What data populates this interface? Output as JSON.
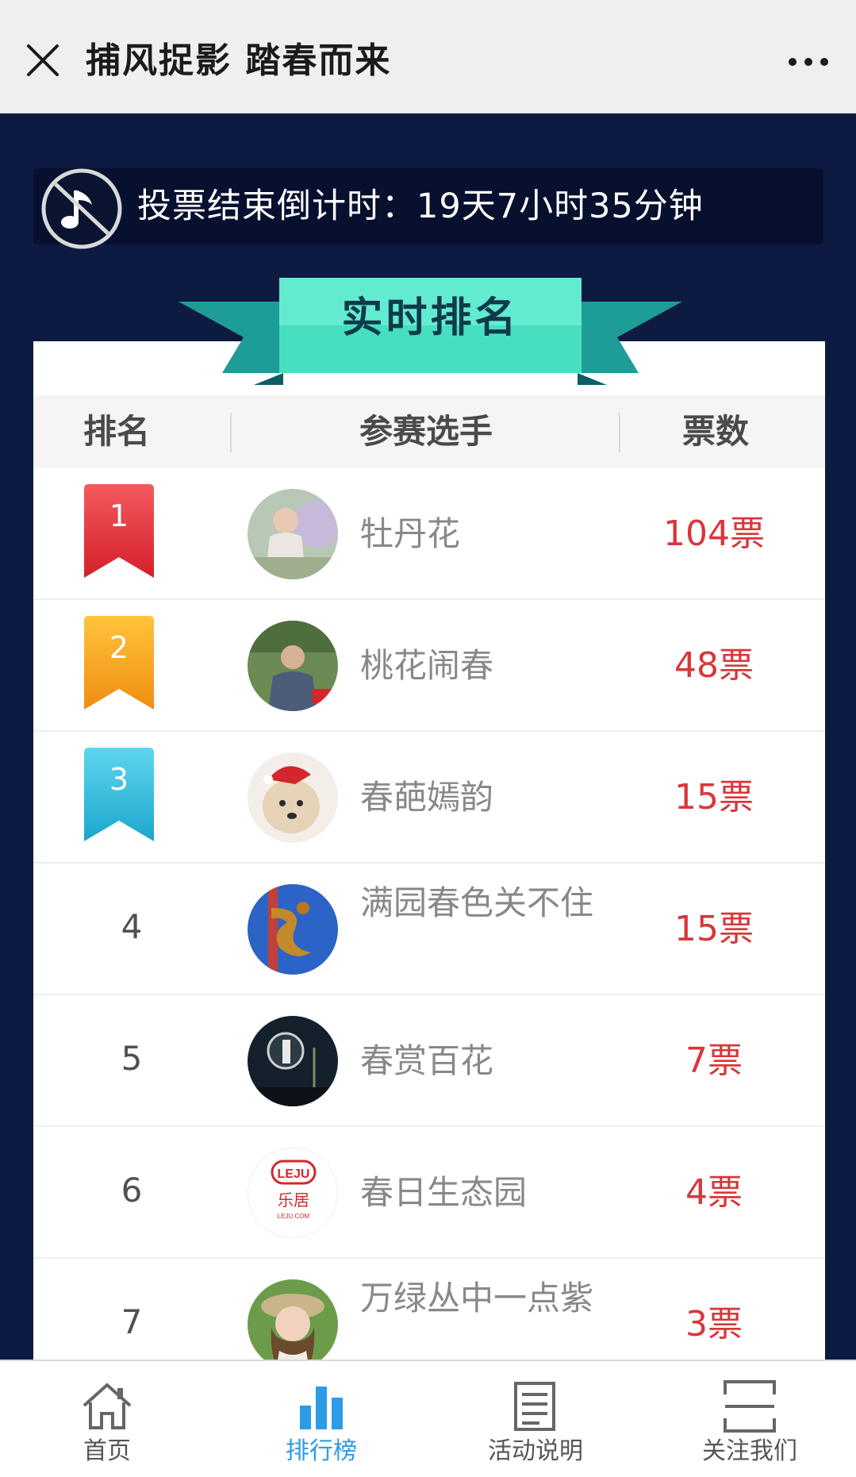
{
  "header": {
    "title": "捕风捉影 踏春而来"
  },
  "countdown": {
    "label": "投票结束倒计时：",
    "value": "19天7小时35分钟"
  },
  "banner": {
    "title": "实时排名"
  },
  "table": {
    "columns": [
      "排名",
      "参赛选手",
      "票数"
    ],
    "rows": [
      {
        "rank": "1",
        "name": "牡丹花",
        "votes": "104票"
      },
      {
        "rank": "2",
        "name": "桃花闹春",
        "votes": "48票"
      },
      {
        "rank": "3",
        "name": "春葩嫣韵",
        "votes": "15票"
      },
      {
        "rank": "4",
        "name": "满园春色关不住",
        "votes": "15票"
      },
      {
        "rank": "5",
        "name": "春赏百花",
        "votes": "7票"
      },
      {
        "rank": "6",
        "name": "春日生态园",
        "votes": "4票"
      },
      {
        "rank": "7",
        "name": "万绿丛中一点紫",
        "votes": "3票"
      }
    ]
  },
  "avatar6_logo": {
    "top": "LEJU",
    "middle": "乐居",
    "bottom": "LEJU.COM"
  },
  "tabbar": {
    "tabs": [
      {
        "label": "首页",
        "icon": "home-icon"
      },
      {
        "label": "排行榜",
        "icon": "bar-chart-icon",
        "active": true
      },
      {
        "label": "活动说明",
        "icon": "document-icon"
      },
      {
        "label": "关注我们",
        "icon": "qr-frame-icon"
      }
    ]
  },
  "colors": {
    "background": "#0d1a42",
    "vote_red": "#d8373b",
    "rank1": "#e0343c",
    "rank2": "#f5a21c",
    "rank3": "#2cb6d8",
    "ribbon": "#3fd8c0",
    "active_tab": "#2d9be6"
  }
}
